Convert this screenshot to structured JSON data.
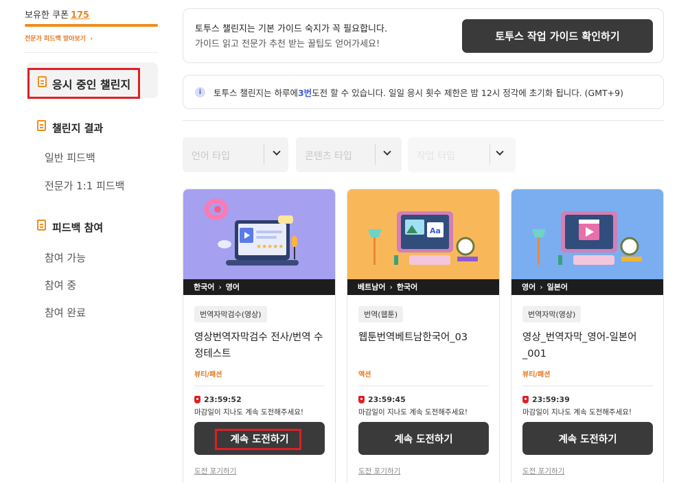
{
  "sidebar": {
    "coupon_label": "보유한 쿠폰",
    "coupon_count": "175",
    "coupon_progress": 1.0,
    "expert_link": "전문가 피드백 받아보기",
    "active_item": "응시 중인 챌린지",
    "sections": [
      {
        "label": "챌린지 결과",
        "items": [
          "일반 피드백",
          "전문가 1:1 피드백"
        ]
      },
      {
        "label": "피드백 참여",
        "items": [
          "참여 가능",
          "참여 중",
          "참여 완료"
        ]
      }
    ]
  },
  "guide": {
    "line1": "토투스 챌린지는 기본 가이드 숙지가 꼭 필요합니다.",
    "line2": "가이드 읽고 전문가 추천 받는 꿀팁도 얻어가세요!",
    "button": "토투스 작업 가이드 확인하기"
  },
  "notice": {
    "before": "토투스 챌린지는 하루에 ",
    "highlight": "3번",
    "after": " 도전 할 수 있습니다. 일일 응시 횟수 제한은 밤 12시 정각에 초기화 됩니다. (GMT+9)"
  },
  "filters": [
    {
      "placeholder": "언어 타입"
    },
    {
      "placeholder": "콘텐츠 타입"
    },
    {
      "placeholder": "작업 타입"
    }
  ],
  "cards": [
    {
      "lang_from": "한국어",
      "lang_to": "영어",
      "tag": "번역자막검수(영상)",
      "title": "영상번역자막검수 전사/번역 수정테스트",
      "category": "뷰티/패션",
      "timer": "23:59:52",
      "message": "마감일이 지나도 계속 도전해주세요!",
      "button": "계속 도전하기",
      "giveup": "도전 포기하기",
      "bg": "#a5a0f0"
    },
    {
      "lang_from": "베트남어",
      "lang_to": "한국어",
      "tag": "번역(웹툰)",
      "title": "웹툰번역베트남한국어_03",
      "category": "액션",
      "timer": "23:59:45",
      "message": "마감일이 지나도 계속 도전해주세요!",
      "button": "계속 도전하기",
      "giveup": "도전 포기하기",
      "bg": "#f8b85a"
    },
    {
      "lang_from": "영어",
      "lang_to": "일본어",
      "tag": "번역자막(영상)",
      "title": "영상_번역자막_영어-일본어_001",
      "category": "뷰티/패션",
      "timer": "23:59:39",
      "message": "마감일이 지나도 계속 도전해주세요!",
      "button": "계속 도전하기",
      "giveup": "도전 포기하기",
      "bg": "#7aaef0"
    }
  ]
}
